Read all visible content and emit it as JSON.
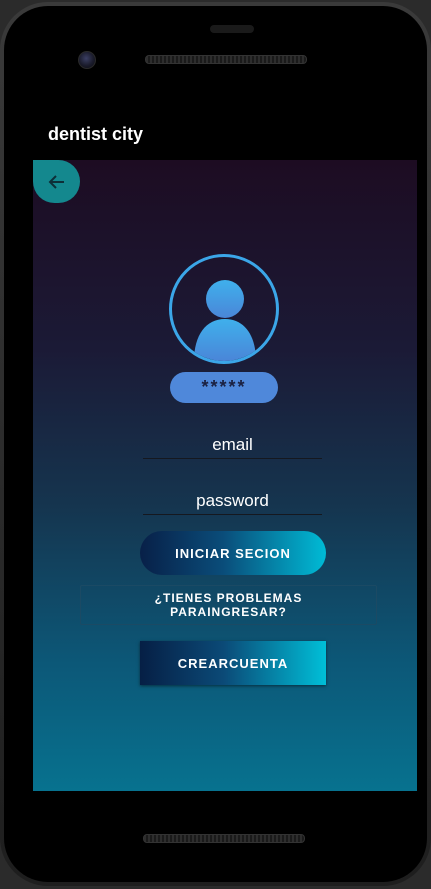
{
  "app": {
    "title": "dentist city"
  },
  "login": {
    "password_mask": "*****",
    "email_placeholder": "email",
    "password_placeholder": "password",
    "login_label": "INICIAR SECION",
    "help_label": "¿TIENES PROBLEMAS PARAINGRESAR?",
    "create_label": "CREARCUENTA"
  },
  "icons": {
    "back": "arrow-left-icon",
    "avatar": "user-avatar-icon"
  },
  "colors": {
    "accent": "#14888e",
    "avatar": "#3ba6e8",
    "badge": "#4f88da",
    "gradient_top": "#1d0c22",
    "gradient_bottom": "#07728f"
  }
}
